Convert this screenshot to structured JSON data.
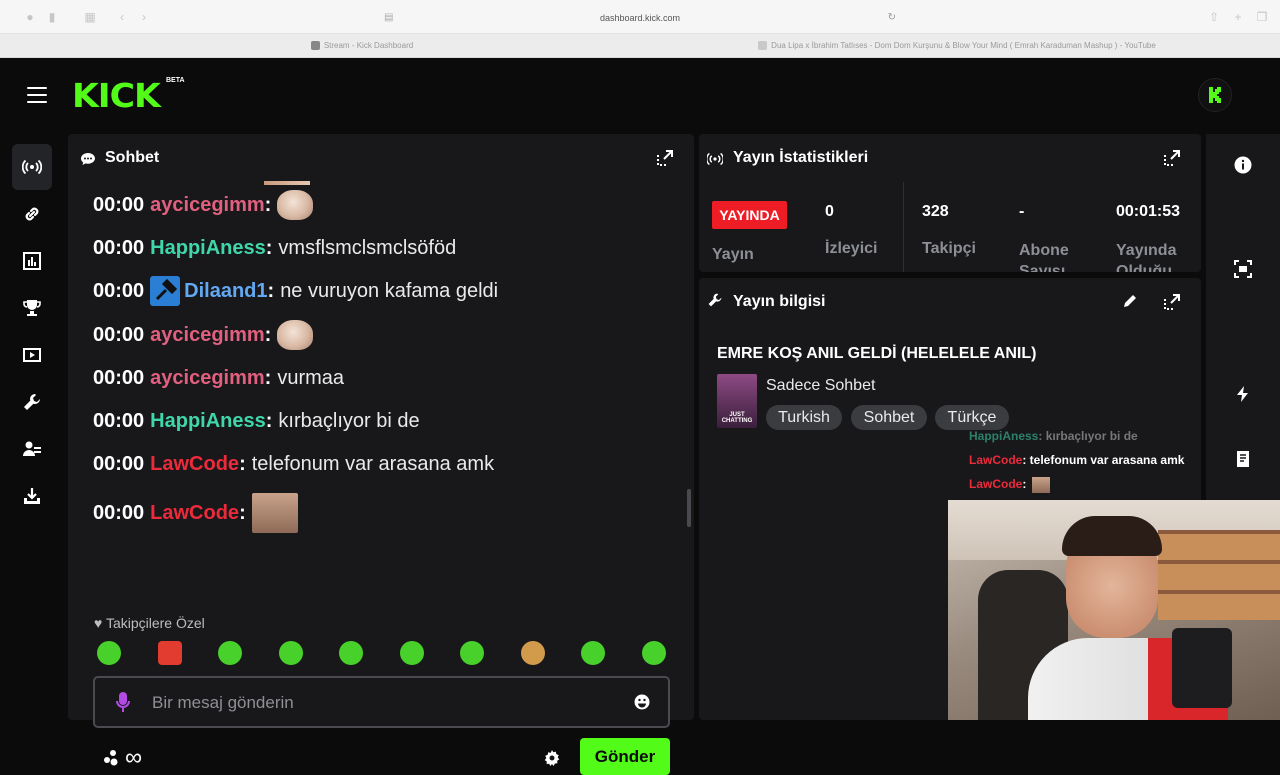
{
  "browser": {
    "url": "dashboard.kick.com",
    "tabs": [
      {
        "label": "Stream - Kick Dashboard"
      },
      {
        "label": "Dua Lipa x İbrahim Tatlıses - Dom Dom Kurşunu & Blow Your Mind ( Emrah Karaduman Mashup ) - YouTube"
      }
    ]
  },
  "header": {
    "logo": "KICK",
    "beta": "BETA"
  },
  "colors": {
    "brand": "#53fc18",
    "live": "#ee1c25",
    "panel": "#18181b",
    "bg": "#0b0b0c"
  },
  "chat": {
    "title": "Sohbet",
    "messages": [
      {
        "time": "00:00",
        "user": "aycicegimm",
        "color": "#e2607f",
        "text": "",
        "emote": "fist"
      },
      {
        "time": "00:00",
        "user": "HappiAness",
        "color": "#3fd6a8",
        "text": "vmsflsmclsmclsöföd"
      },
      {
        "time": "00:00",
        "user": "Dilaand1",
        "color": "#62a8f2",
        "text": "ne vuruyon kafama geldi",
        "badge": "moderator"
      },
      {
        "time": "00:00",
        "user": "aycicegimm",
        "color": "#e2607f",
        "text": "",
        "emote": "fist"
      },
      {
        "time": "00:00",
        "user": "aycicegimm",
        "color": "#e2607f",
        "text": "vurmaa"
      },
      {
        "time": "00:00",
        "user": "HappiAness",
        "color": "#3fd6a8",
        "text": "kırbaçlıyor bi de"
      },
      {
        "time": "00:00",
        "user": "LawCode",
        "color": "#ec2a3b",
        "text": "telefonum var arasana amk"
      },
      {
        "time": "00:00",
        "user": "LawCode",
        "color": "#ec2a3b",
        "text": "",
        "emote": "face"
      }
    ],
    "followers_only_label": "Takipçilere Özel",
    "input_placeholder": "Bir mesaj gönderin",
    "send_label": "Gönder",
    "infinity": "∞"
  },
  "stats": {
    "title": "Yayın İstatistikleri",
    "live_badge": "YAYINDA",
    "items": [
      {
        "value": "0",
        "label": "İzleyici"
      },
      {
        "value": "328",
        "label": "Takipçi"
      },
      {
        "value": "-",
        "label": "Abone Sayısı"
      },
      {
        "value": "00:01:53",
        "label": "Yayında Olduğu"
      }
    ],
    "stream_label": "Yayın"
  },
  "info": {
    "title": "Yayın bilgisi",
    "stream_title": "EMRE KOŞ ANIL GELDİ (HELELELE ANIL)",
    "category": "Sadece Sohbet",
    "category_thumb_text": "JUST CHATTING",
    "tags": [
      "Turkish",
      "Sohbet",
      "Türkçe"
    ]
  },
  "overlay_chat": [
    {
      "user": "HappiAness",
      "text": ": kırbaçlıyor bi de",
      "color": "#3fd6a8"
    },
    {
      "user": "LawCode",
      "text": ": telefonum var arasana amk",
      "color": "#ec2a3b"
    },
    {
      "user": "LawCode",
      "text": ":",
      "color": "#ec2a3b"
    }
  ]
}
